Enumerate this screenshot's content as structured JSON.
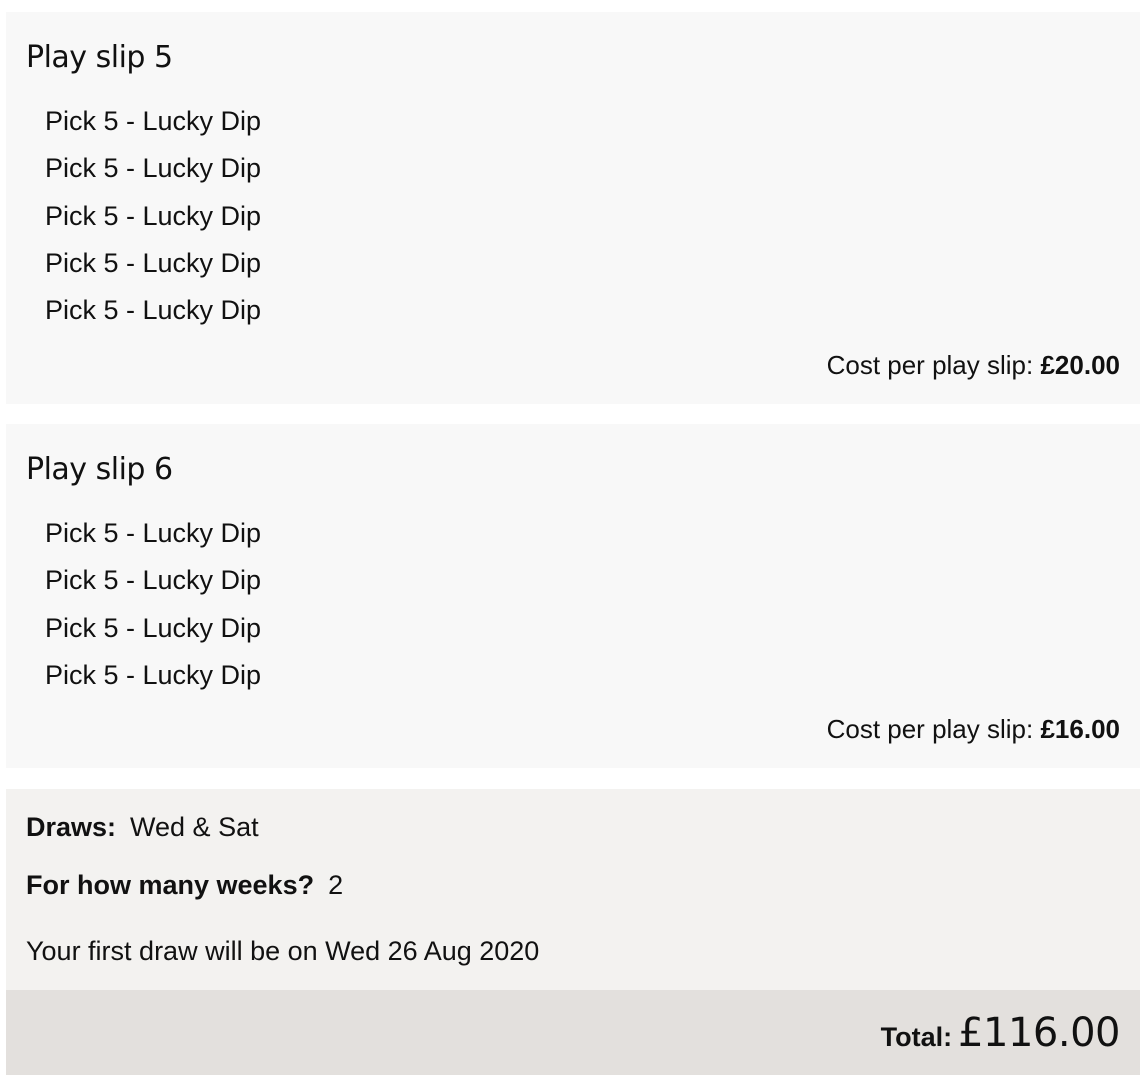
{
  "slips": [
    {
      "title": "Play slip 5",
      "lines": [
        "Pick 5 - Lucky Dip",
        "Pick 5 - Lucky Dip",
        "Pick 5 - Lucky Dip",
        "Pick 5 - Lucky Dip",
        "Pick 5 - Lucky Dip"
      ],
      "cost_label": "Cost per play slip:",
      "cost_value": "£20.00"
    },
    {
      "title": "Play slip 6",
      "lines": [
        "Pick 5 - Lucky Dip",
        "Pick 5 - Lucky Dip",
        "Pick 5 - Lucky Dip",
        "Pick 5 - Lucky Dip"
      ],
      "cost_label": "Cost per play slip:",
      "cost_value": "£16.00"
    }
  ],
  "summary": {
    "draws_label": "Draws:",
    "draws_value": "Wed & Sat",
    "weeks_label": "For how many weeks?",
    "weeks_value": "2",
    "first_draw": "Your first draw will be on Wed 26 Aug 2020"
  },
  "total": {
    "label": "Total:",
    "value": "£116.00"
  },
  "colors": {
    "slip_background": "#f8f8f8",
    "summary_background": "#f3f2f0",
    "total_background": "#e3e0dd",
    "text": "#111111"
  }
}
